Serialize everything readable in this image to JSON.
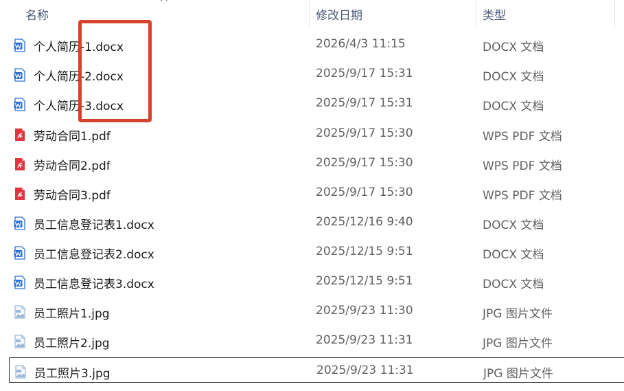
{
  "columns": {
    "name": "名称",
    "date": "修改日期",
    "type": "类型"
  },
  "colors": {
    "highlight": "#d4432c",
    "word_icon": "#2b6fd6",
    "pdf_icon": "#e0363f",
    "image_icon": "#9bb7d8"
  },
  "files": [
    {
      "name": "个人简历-1.docx",
      "date": "2026/4/3 11:15",
      "type": "DOCX 文档",
      "icon": "word-doc-icon"
    },
    {
      "name": "个人简历-2.docx",
      "date": "2025/9/17 15:31",
      "type": "DOCX 文档",
      "icon": "word-doc-icon"
    },
    {
      "name": "个人简历-3.docx",
      "date": "2025/9/17 15:31",
      "type": "DOCX 文档",
      "icon": "word-doc-icon"
    },
    {
      "name": "劳动合同1.pdf",
      "date": "2025/9/17 15:30",
      "type": "WPS PDF 文档",
      "icon": "pdf-doc-icon"
    },
    {
      "name": "劳动合同2.pdf",
      "date": "2025/9/17 15:30",
      "type": "WPS PDF 文档",
      "icon": "pdf-doc-icon"
    },
    {
      "name": "劳动合同3.pdf",
      "date": "2025/9/17 15:30",
      "type": "WPS PDF 文档",
      "icon": "pdf-doc-icon"
    },
    {
      "name": "员工信息登记表1.docx",
      "date": "2025/12/16 9:40",
      "type": "DOCX 文档",
      "icon": "word-doc-icon"
    },
    {
      "name": "员工信息登记表2.docx",
      "date": "2025/12/15 9:51",
      "type": "DOCX 文档",
      "icon": "word-doc-icon"
    },
    {
      "name": "员工信息登记表3.docx",
      "date": "2025/12/15 9:51",
      "type": "DOCX 文档",
      "icon": "word-doc-icon"
    },
    {
      "name": "员工照片1.jpg",
      "date": "2025/9/23 11:30",
      "type": "JPG 图片文件",
      "icon": "jpg-image-icon"
    },
    {
      "name": "员工照片2.jpg",
      "date": "2025/9/23 11:31",
      "type": "JPG 图片文件",
      "icon": "jpg-image-icon"
    },
    {
      "name": "员工照片3.jpg",
      "date": "2025/9/23 11:31",
      "type": "JPG 图片文件",
      "icon": "jpg-image-icon",
      "selected": true
    }
  ]
}
